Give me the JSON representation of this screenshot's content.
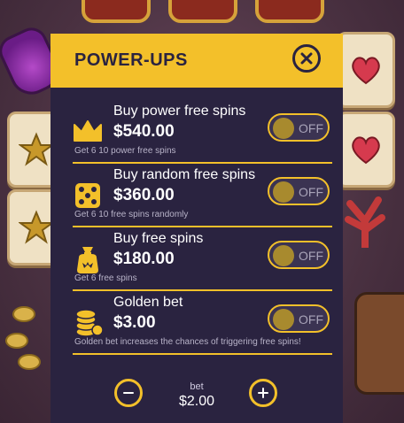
{
  "panel": {
    "title": "POWER-UPS"
  },
  "items": [
    {
      "title": "Buy power free spins",
      "price": "$540.00",
      "description": "Get 6 10 power free spins",
      "toggle": "OFF",
      "icon": "crown-icon"
    },
    {
      "title": "Buy random free spins",
      "price": "$360.00",
      "description": "Get 6 10 free spins randomly",
      "toggle": "OFF",
      "icon": "dice-icon"
    },
    {
      "title": "Buy free spins",
      "price": "$180.00",
      "description": "Get 6 free spins",
      "toggle": "OFF",
      "icon": "money-bag-icon"
    },
    {
      "title": "Golden bet",
      "price": "$3.00",
      "description": "Golden bet increases the chances of triggering free spins!",
      "toggle": "OFF",
      "icon": "coin-stack-icon"
    }
  ],
  "bet": {
    "label": "bet",
    "value": "$2.00"
  },
  "colors": {
    "accent": "#f3c02a",
    "panel": "#2a2340",
    "text": "#ffffff"
  }
}
